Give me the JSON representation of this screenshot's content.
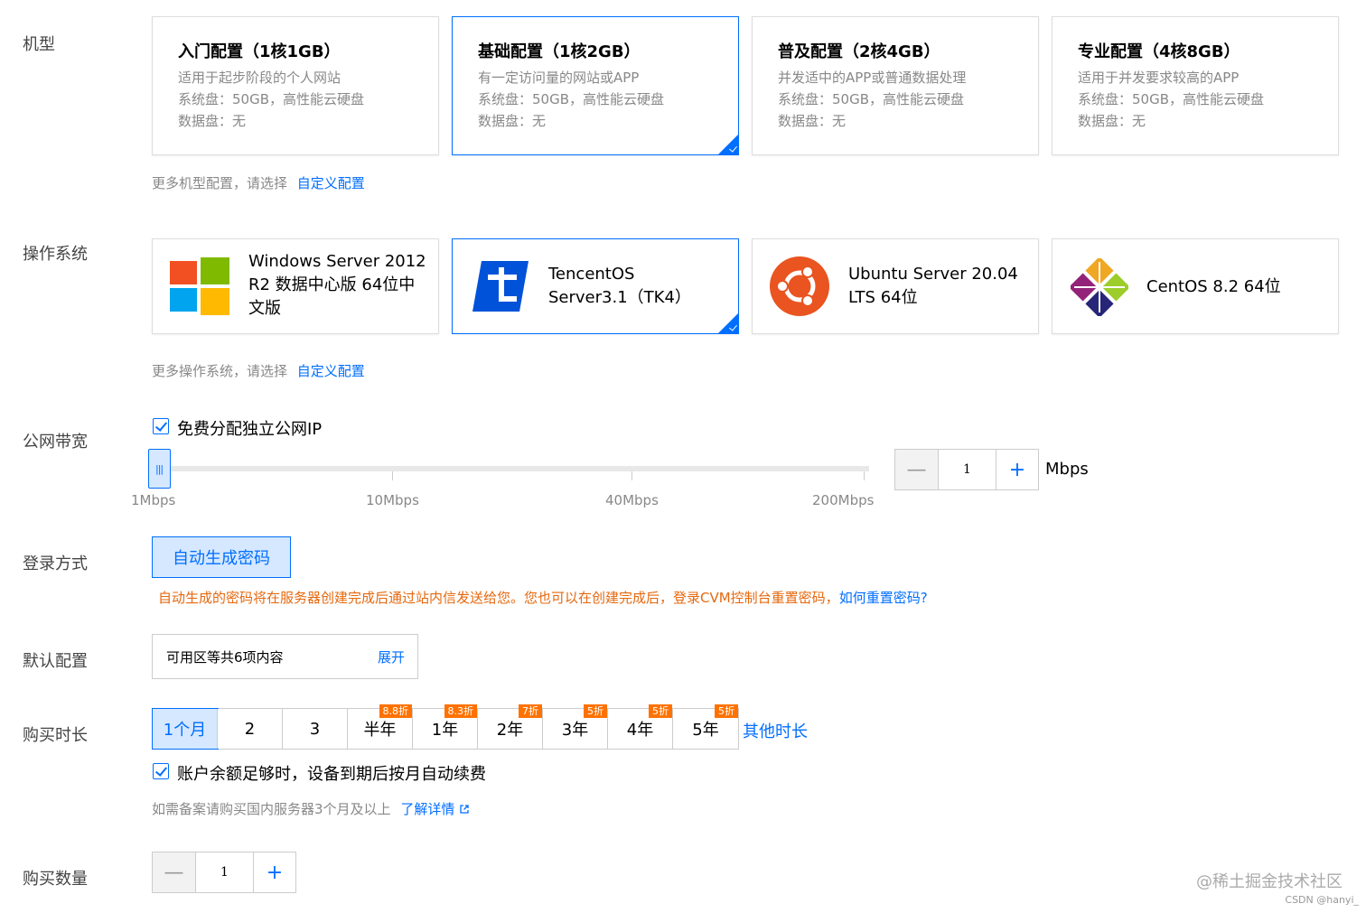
{
  "labels": {
    "instance_type": "机型",
    "os": "操作系统",
    "bandwidth": "公网带宽",
    "login": "登录方式",
    "default_config": "默认配置",
    "duration": "购买时长",
    "quantity": "购买数量"
  },
  "instance_cards": [
    {
      "title": "入门配置（1核1GB）",
      "desc": "适用于起步阶段的个人网站",
      "system_disk": "系统盘：50GB，高性能云硬盘",
      "data_disk": "数据盘：无",
      "selected": false
    },
    {
      "title": "基础配置（1核2GB）",
      "desc": "有一定访问量的网站或APP",
      "system_disk": "系统盘：50GB，高性能云硬盘",
      "data_disk": "数据盘：无",
      "selected": true
    },
    {
      "title": "普及配置（2核4GB）",
      "desc": "并发适中的APP或普通数据处理",
      "system_disk": "系统盘：50GB，高性能云硬盘",
      "data_disk": "数据盘：无",
      "selected": false
    },
    {
      "title": "专业配置（4核8GB）",
      "desc": "适用于并发要求较高的APP",
      "system_disk": "系统盘：50GB，高性能云硬盘",
      "data_disk": "数据盘：无",
      "selected": false
    }
  ],
  "instance_more": {
    "text": "更多机型配置，请选择",
    "link": "自定义配置"
  },
  "os_cards": [
    {
      "name_lines": [
        "Windows Server 2012",
        "R2 数据中心版 64位中",
        "文版"
      ],
      "icon": "windows-logo-icon",
      "selected": false
    },
    {
      "name_lines": [
        "TencentOS",
        "Server3.1（TK4）"
      ],
      "icon": "tencentos-logo-icon",
      "selected": true
    },
    {
      "name_lines": [
        "Ubuntu Server 20.04",
        "LTS 64位"
      ],
      "icon": "ubuntu-logo-icon",
      "selected": false
    },
    {
      "name_lines": [
        "CentOS 8.2 64位"
      ],
      "icon": "centos-logo-icon",
      "selected": false
    }
  ],
  "os_more": {
    "text": "更多操作系统，请选择",
    "link": "自定义配置"
  },
  "bandwidth": {
    "free_ip_label": "免费分配独立公网IP",
    "free_ip_checked": true,
    "ticks": [
      "1Mbps",
      "10Mbps",
      "40Mbps",
      "200Mbps"
    ],
    "value": "1",
    "unit": "Mbps",
    "minus": "—",
    "plus": "+"
  },
  "login": {
    "button": "自动生成密码",
    "notice": "自动生成的密码将在服务器创建完成后通过站内信发送给您。您也可以在创建完成后，登录CVM控制台重置密码，",
    "notice_link": "如何重置密码?"
  },
  "default_config": {
    "summary": "可用区等共6项内容",
    "expand": "展开"
  },
  "duration": {
    "options": [
      {
        "label": "1个月",
        "badge": "",
        "selected": true
      },
      {
        "label": "2",
        "badge": "",
        "selected": false
      },
      {
        "label": "3",
        "badge": "",
        "selected": false
      },
      {
        "label": "半年",
        "badge": "8.8折",
        "selected": false
      },
      {
        "label": "1年",
        "badge": "8.3折",
        "selected": false
      },
      {
        "label": "2年",
        "badge": "7折",
        "selected": false
      },
      {
        "label": "3年",
        "badge": "5折",
        "selected": false
      },
      {
        "label": "4年",
        "badge": "5折",
        "selected": false
      },
      {
        "label": "5年",
        "badge": "5折",
        "selected": false
      }
    ],
    "other_link": "其他时长",
    "auto_renew_label": "账户余额足够时，设备到期后按月自动续费",
    "auto_renew_checked": true,
    "filing_hint": "如需备案请购买国内服务器3个月及以上",
    "filing_link": "了解详情"
  },
  "quantity": {
    "value": "1",
    "minus": "—",
    "plus": "+"
  },
  "watermark": "@稀土掘金技术社区",
  "csdn": "CSDN @hanyi_",
  "colors": {
    "accent": "#006eff",
    "warning": "#e5680e",
    "badge": "#ff7200"
  }
}
